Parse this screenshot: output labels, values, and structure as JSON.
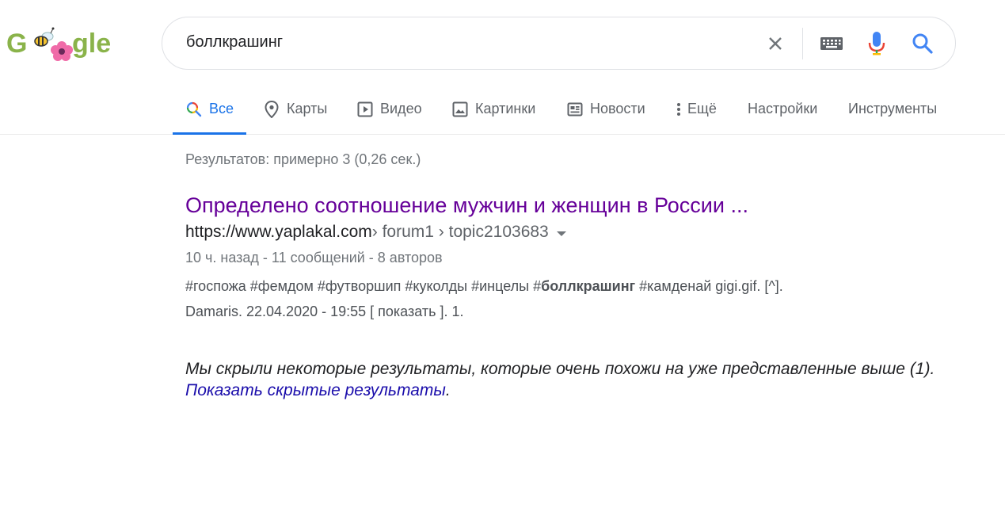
{
  "logo": {
    "letter_g": "G",
    "suffix": "gle"
  },
  "search": {
    "query": "боллкрашинг",
    "clear_icon": "close-icon",
    "keyboard_icon": "keyboard-icon",
    "mic_icon": "mic-icon",
    "search_icon": "search-icon"
  },
  "tabs": [
    {
      "label": "Все",
      "icon": "search-icon",
      "active": true
    },
    {
      "label": "Карты",
      "icon": "map-pin-icon"
    },
    {
      "label": "Видео",
      "icon": "video-icon"
    },
    {
      "label": "Картинки",
      "icon": "image-icon"
    },
    {
      "label": "Новости",
      "icon": "news-icon"
    },
    {
      "label": "Ещё",
      "icon": "more-vertical-icon"
    },
    {
      "label": "Настройки"
    },
    {
      "label": "Инструменты"
    }
  ],
  "stats": "Результатов: примерно 3 (0,26 сек.)",
  "result": {
    "title": "Определено соотношение мужчин и женщин в России ...",
    "url_host": "https://www.yaplakal.com",
    "url_path": " › forum1 › topic2103683",
    "meta": "10 ч. назад - 11 сообщений - 8 авторов",
    "snippet_before": "#госпожа #фемдом #футворшип #куколды #инцелы #",
    "snippet_bold": "боллкрашинг",
    "snippet_after": " #камденай gigi.gif. [^].",
    "snippet_line2": "Damaris. 22.04.2020 - 19:55 [ показать ]. 1."
  },
  "omitted": {
    "text": "Мы скрыли некоторые результаты, которые очень похожи на уже представленные выше (1).",
    "link": "Показать скрытые результаты",
    "trail": "."
  },
  "colors": {
    "accent": "#1a73e8",
    "visited": "#660099",
    "link": "#1a0dab"
  }
}
